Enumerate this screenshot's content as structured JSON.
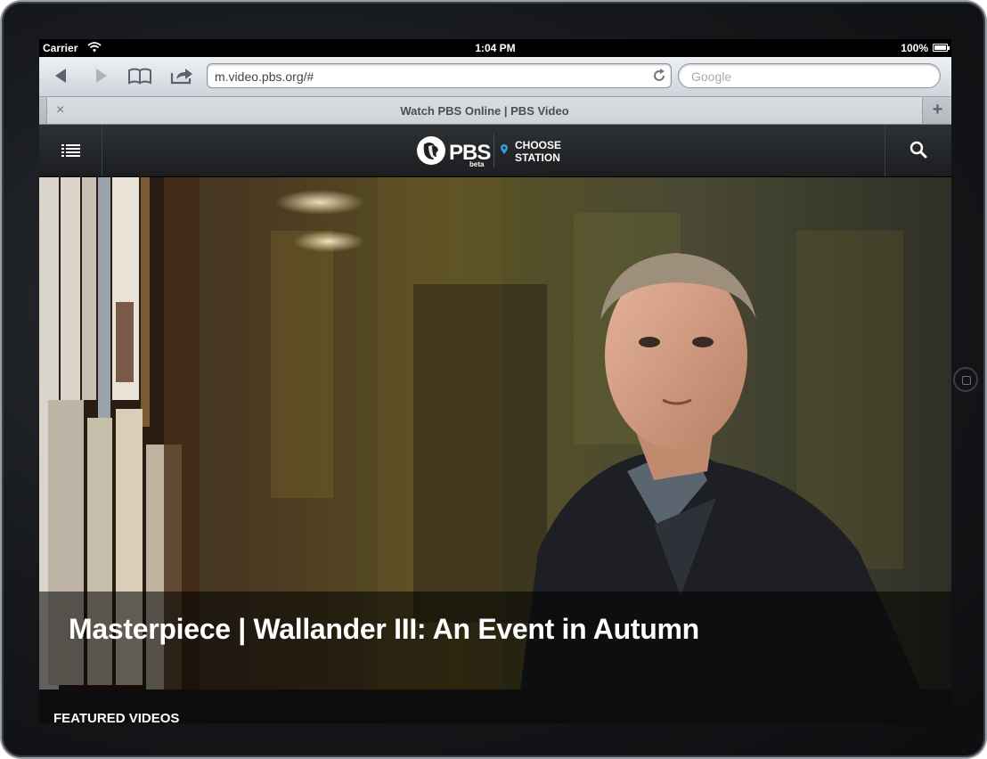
{
  "status_bar": {
    "carrier": "Carrier",
    "time": "1:04 PM",
    "battery": "100%"
  },
  "browser": {
    "url": "m.video.pbs.org/#",
    "search_placeholder": "Google",
    "tab_title": "Watch PBS Online | PBS Video",
    "tab_close": "×",
    "new_tab": "+"
  },
  "pbs": {
    "logo_text": "PBS",
    "logo_badge": "beta",
    "station_line1": "CHOOSE",
    "station_line2": "STATION",
    "accent_color": "#2aa3e0"
  },
  "hero": {
    "title": "Masterpiece | Wallander III: An Event in Autumn"
  },
  "featured": {
    "label": "FEATURED VIDEOS"
  }
}
